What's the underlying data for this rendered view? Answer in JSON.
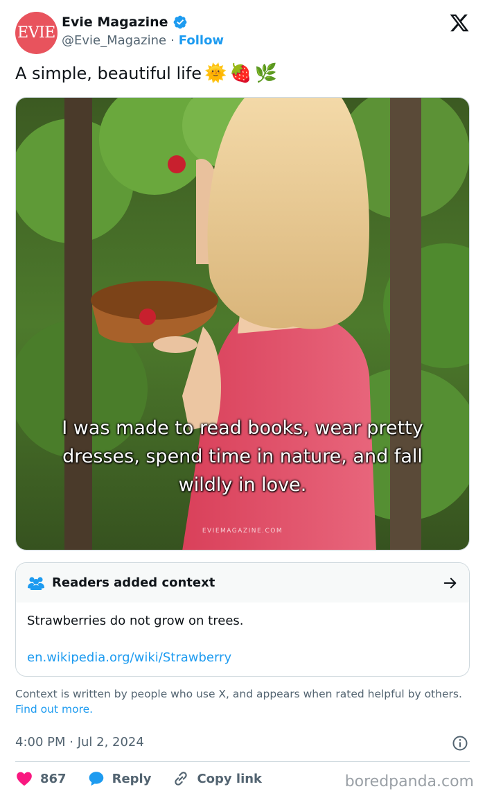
{
  "author": {
    "avatar_text": "EVIE",
    "name": "Evie Magazine",
    "handle": "@Evie_Magazine",
    "separator": "·",
    "follow_label": "Follow"
  },
  "tweet": {
    "text": "A simple, beautiful life",
    "emojis": [
      "🌞",
      "🍓",
      "🌿"
    ]
  },
  "media": {
    "overlay_lines": [
      "I was made to read books, wear pretty",
      "dresses, spend time in nature, and fall",
      "wildly in love."
    ],
    "watermark": "EVIEMAGAZINE.COM"
  },
  "context_note": {
    "title": "Readers added context",
    "body": "Strawberries do not grow on trees.",
    "link": "en.wikipedia.org/wiki/Strawberry"
  },
  "context_info": {
    "text": "Context is written by people who use X, and appears when rated helpful by others.",
    "link": "Find out more."
  },
  "timestamp": "4:00 PM · Jul 2, 2024",
  "actions": {
    "likes": "867",
    "reply_label": "Reply",
    "copy_label": "Copy link"
  },
  "credit": "boredpanda.com",
  "colors": {
    "accent": "#1d9bf0",
    "like": "#f91880",
    "avatar_bg": "#e8535d"
  }
}
